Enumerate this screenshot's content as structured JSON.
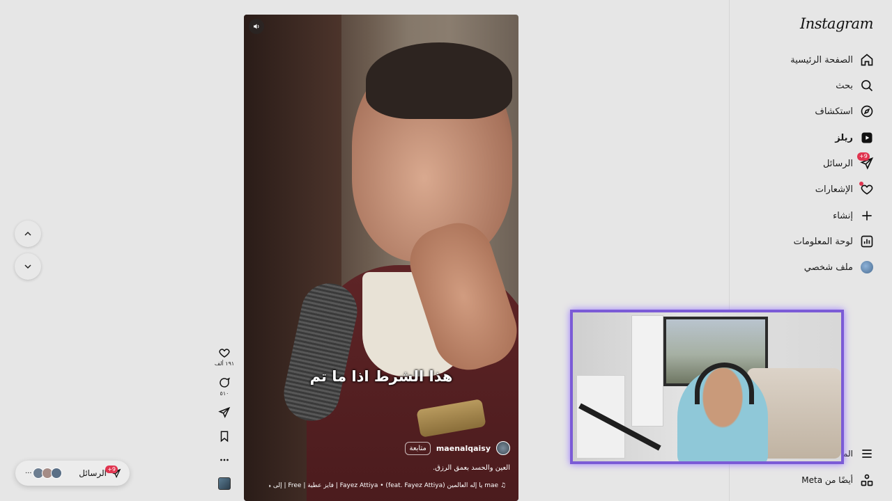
{
  "sidebar": {
    "logo": "Instagram",
    "items": [
      {
        "label": "الصفحة الرئيسية",
        "icon": "home-icon"
      },
      {
        "label": "بحث",
        "icon": "search-icon"
      },
      {
        "label": "استكشاف",
        "icon": "compass-icon"
      },
      {
        "label": "ريلز",
        "icon": "reels-icon",
        "active": true
      },
      {
        "label": "الرسائل",
        "icon": "messages-icon",
        "badge": "+9"
      },
      {
        "label": "الإشعارات",
        "icon": "heart-icon"
      },
      {
        "label": "إنشاء",
        "icon": "plus-icon"
      },
      {
        "label": "لوحة المعلومات",
        "icon": "dashboard-icon"
      },
      {
        "label": "ملف شخصي",
        "icon": "avatar"
      }
    ],
    "more_label": "المزيد",
    "meta_label": "أيضًا من Meta"
  },
  "reel": {
    "subtitle": "هذا الشرط اذا ما تم",
    "author": "maenalqaisy",
    "follow_label": "متابعة",
    "caption": "العين والحسد بعمق الرزق.",
    "music": "♫ mae  يا إله العالمين (feat. Fayez Attiya) • Fayez Attiya | فايز عطية | Free | إلى متى | ء"
  },
  "actions": {
    "likes": "١٩١ ألف",
    "comments": "٥١٠"
  },
  "messages_pill": {
    "label": "الرسائل",
    "badge": "+9",
    "more": "···"
  },
  "colors": {
    "accent_badge": "#e0344f",
    "cam_border": "#7b5bd6"
  }
}
